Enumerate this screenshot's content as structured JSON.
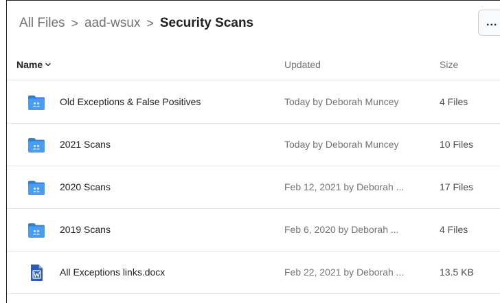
{
  "breadcrumb": {
    "items": [
      "All Files",
      "aad-wsux"
    ],
    "separator": ">",
    "current": "Security Scans"
  },
  "more_button": {
    "label": "...",
    "icon": "more-horizontal-icon"
  },
  "table": {
    "headers": {
      "name": "Name",
      "updated": "Updated",
      "size": "Size"
    },
    "sort_icon": "chevron-down-icon",
    "rows": [
      {
        "name": "Old Exceptions & False Positives",
        "updated": "Today by Deborah Muncey",
        "size": "4 Files",
        "icon": "shared-folder-icon"
      },
      {
        "name": "2021 Scans",
        "updated": "Today by Deborah Muncey",
        "size": "10 Files",
        "icon": "shared-folder-icon"
      },
      {
        "name": "2020 Scans",
        "updated": "Feb 12, 2021 by Deborah ...",
        "size": "17 Files",
        "icon": "shared-folder-icon"
      },
      {
        "name": "2019 Scans",
        "updated": "Feb 6, 2020 by Deborah ...",
        "size": "4 Files",
        "icon": "shared-folder-icon"
      },
      {
        "name": "All Exceptions links.docx",
        "updated": "Feb 22, 2021 by Deborah ...",
        "size": "13.5 KB",
        "icon": "word-document-icon"
      }
    ]
  },
  "colors": {
    "folder": "#4a9cf0",
    "folder_tab": "#2f7fd8",
    "word": "#2b5cb8",
    "text_primary": "#202122",
    "text_secondary": "#6e7376",
    "divider": "#e3e4e5"
  }
}
